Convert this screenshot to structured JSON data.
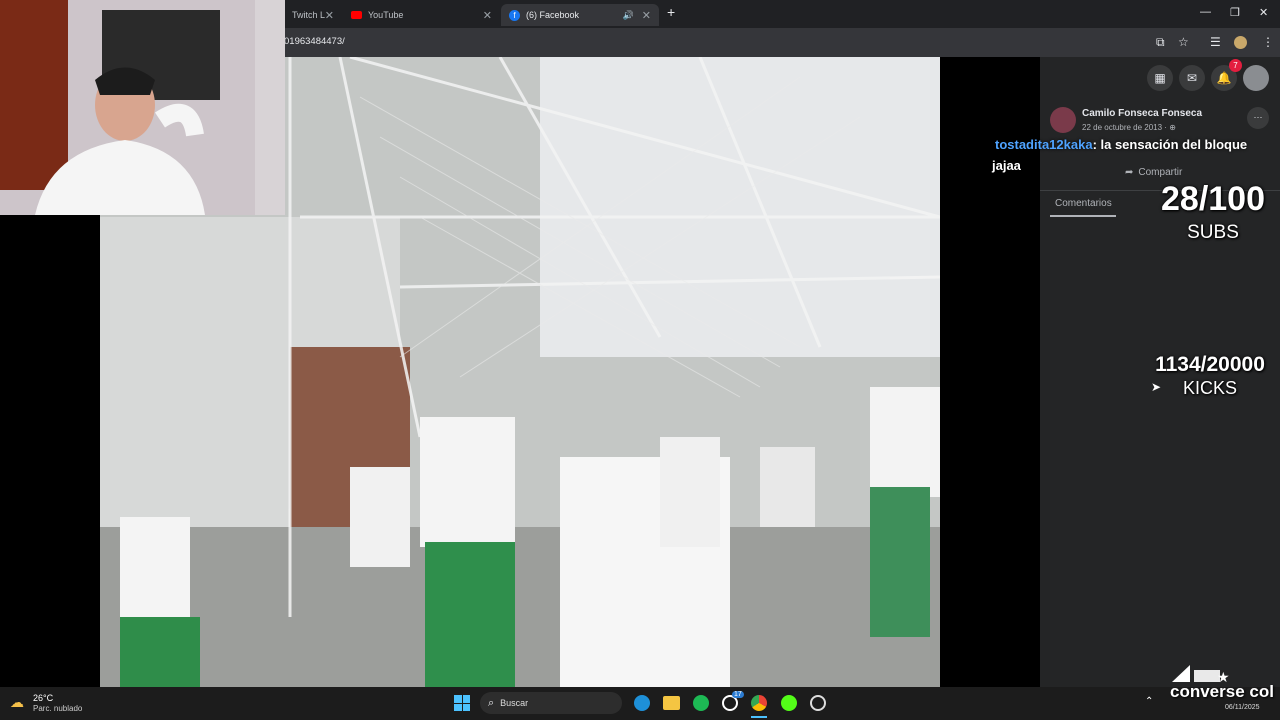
{
  "browser": {
    "tabs": [
      {
        "label": "Twitch Live ..."
      },
      {
        "label": "YouTube"
      },
      {
        "label": "(6) Facebook"
      }
    ],
    "url": "01963484473/"
  },
  "facebook": {
    "notification_count": "7",
    "post_author": "Camilo Fonseca Fonseca",
    "post_date": "22 de octubre de 2013 · ",
    "share_label": "Compartir",
    "comments_tab": "Comentarios",
    "more_label": "···"
  },
  "chat": {
    "msg1_user": "tostadita12kaka",
    "msg1_text": ": la sensación del bloque",
    "msg2_text": "jajaa"
  },
  "stream_overlay": {
    "subs_value": "28/100",
    "subs_label": "SUBS",
    "kicks_value": "1134/20000",
    "kicks_label": "KICKS",
    "brand": "converse col"
  },
  "taskbar": {
    "weather_temp": "26°C",
    "weather_desc": "Parc. nublado",
    "search_placeholder": "Buscar",
    "date": "06/11/2025",
    "whatsapp_badge": "17"
  },
  "colors": {
    "chat_user": "#4fa3ff",
    "badge_red": "#e41e3f",
    "fb_panel": "#242526"
  }
}
